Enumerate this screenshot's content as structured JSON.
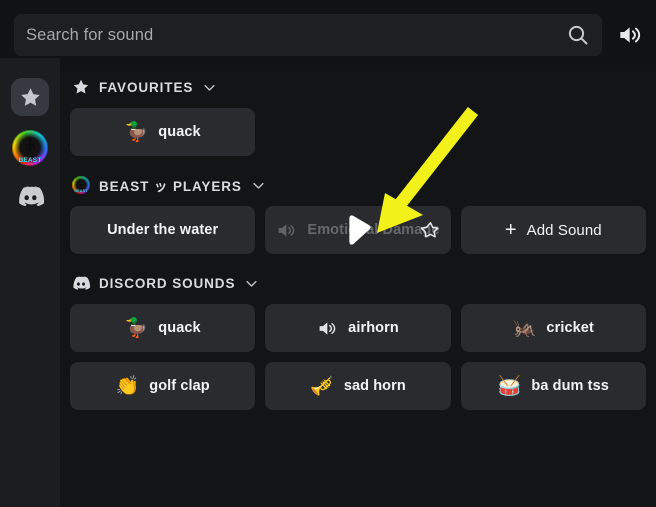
{
  "search": {
    "placeholder": "Search for sound",
    "value": "",
    "search_icon": "search-icon",
    "volume_icon": "volume-icon"
  },
  "rail": {
    "items": [
      {
        "name": "favourites-tab",
        "icon": "star-icon",
        "active": true
      },
      {
        "name": "beast-players-server-tab",
        "icon": "server-avatar",
        "label": "BEAST",
        "active": false
      },
      {
        "name": "discord-sounds-tab",
        "icon": "discord-icon",
        "active": false
      }
    ]
  },
  "sections": [
    {
      "id": "favourites",
      "title": "FAVOURITES",
      "icon": "star-icon",
      "chevron": "chevron-down-icon",
      "sounds": [
        {
          "name": "quack",
          "emoji": "🦆",
          "icon_type": "emoji",
          "state": "normal"
        }
      ]
    },
    {
      "id": "beast-players",
      "title": "BEAST ッ PLAYERS",
      "icon": "server-avatar",
      "chevron": "chevron-down-icon",
      "sounds": [
        {
          "name": "Under the water",
          "icon_type": "none",
          "state": "normal"
        },
        {
          "name": "Emotional Damage",
          "icon_type": "speaker",
          "state": "hovered",
          "play_icon": "play-icon",
          "fav_icon": "star-outline-icon"
        },
        {
          "name": "Add Sound",
          "icon_type": "plus",
          "plus": "+",
          "state": "action"
        }
      ]
    },
    {
      "id": "discord-sounds",
      "title": "DISCORD SOUNDS",
      "icon": "discord-icon",
      "chevron": "chevron-down-icon",
      "sounds": [
        {
          "name": "quack",
          "emoji": "🦆",
          "icon_type": "emoji",
          "state": "normal"
        },
        {
          "name": "airhorn",
          "icon_type": "speaker",
          "state": "normal"
        },
        {
          "name": "cricket",
          "emoji": "🦗",
          "icon_type": "emoji",
          "state": "normal"
        },
        {
          "name": "golf clap",
          "emoji": "👏",
          "icon_type": "emoji",
          "state": "normal"
        },
        {
          "name": "sad horn",
          "emoji": "🎺",
          "icon_type": "emoji",
          "state": "normal"
        },
        {
          "name": "ba dum tss",
          "emoji": "🥁",
          "icon_type": "emoji",
          "state": "normal"
        }
      ]
    }
  ],
  "annotation": {
    "name": "yellow-arrow-annotation",
    "color": "#f2f21a",
    "points_to": "play-button-on-emotional-damage"
  },
  "colors": {
    "app_background": "#131416",
    "rail_background": "#1b1d20",
    "search_background": "#111214",
    "search_field": "#1d1f22",
    "card_background": "#292b2f",
    "text_primary": "#f2f3f5",
    "text_secondary": "#d8dbe0",
    "accent_yellow": "#f2f21a"
  }
}
